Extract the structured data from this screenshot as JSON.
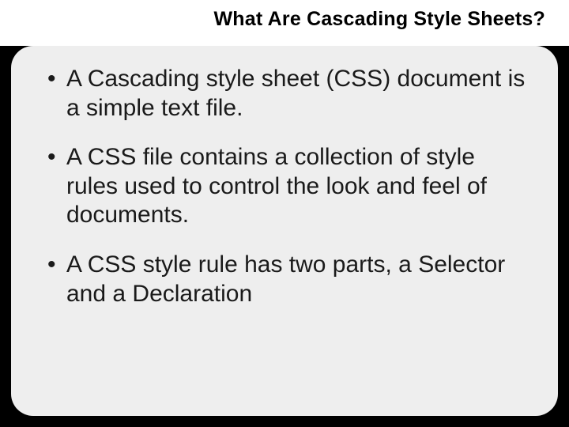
{
  "slide": {
    "title": "What Are Cascading Style Sheets?",
    "bullets": [
      "A Cascading style sheet (CSS) document is a simple text file.",
      "A CSS file contains a collection of style rules used to control the look and feel of documents.",
      "A CSS style rule has two parts, a Selector and a Declaration"
    ]
  }
}
